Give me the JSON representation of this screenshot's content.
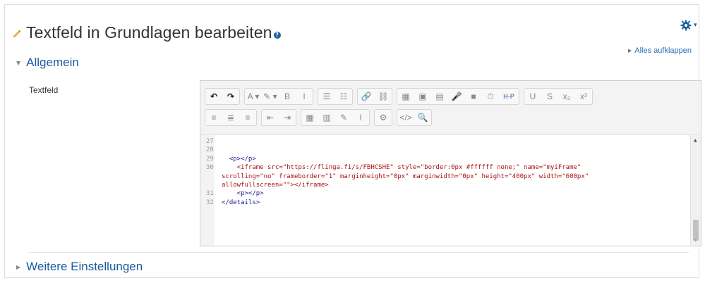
{
  "page": {
    "title": "Textfeld in Grundlagen bearbeiten",
    "help_icon": "?",
    "expand_all": "Alles aufklappen"
  },
  "icons": {
    "pencil": "pencil-icon",
    "help": "help-icon",
    "gear": "gear-icon",
    "accent_color": "#1f5f9b"
  },
  "sections": {
    "general": "Allgemein",
    "more_settings": "Weitere Einstellungen"
  },
  "field": {
    "label": "Textfeld"
  },
  "toolbar": {
    "row1": [
      [
        "↶",
        "↷"
      ],
      [
        "A ▾",
        "✎ ▾",
        "B",
        "I"
      ],
      [
        "☰",
        "☷"
      ],
      [
        "🔗",
        "⛓"
      ],
      [
        "▦",
        "▣",
        "▤",
        "🎤",
        "■",
        "⏱",
        "H-P"
      ],
      [
        "U",
        "S",
        "x₂",
        "x²"
      ]
    ],
    "row2": [
      [
        "≡",
        "≣",
        "≡"
      ],
      [
        "⇤",
        "⇥"
      ],
      [
        "▦",
        "▥",
        "✎",
        "I"
      ],
      [
        "⚙"
      ],
      [
        "</>",
        "🔍"
      ]
    ]
  },
  "code": {
    "lines": [
      {
        "n": "27",
        "html": ""
      },
      {
        "n": "28",
        "html": ""
      },
      {
        "n": "29",
        "html": "  <p></p>"
      },
      {
        "n": "30",
        "html": "    <iframe src=\"https://flinga.fi/s/FBHCSHE\" style=\"border:0px #ffffff none;\" name=\"myiFrame\""
      },
      {
        "n": "",
        "html": "scrolling=\"no\" frameborder=\"1\" marginheight=\"0px\" marginwidth=\"0px\" height=\"400px\" width=\"600px\""
      },
      {
        "n": "",
        "html": "allowfullscreen=\"\"></iframe>"
      },
      {
        "n": "31",
        "html": "    <p></p>"
      },
      {
        "n": "32",
        "html": "</details>"
      }
    ]
  }
}
